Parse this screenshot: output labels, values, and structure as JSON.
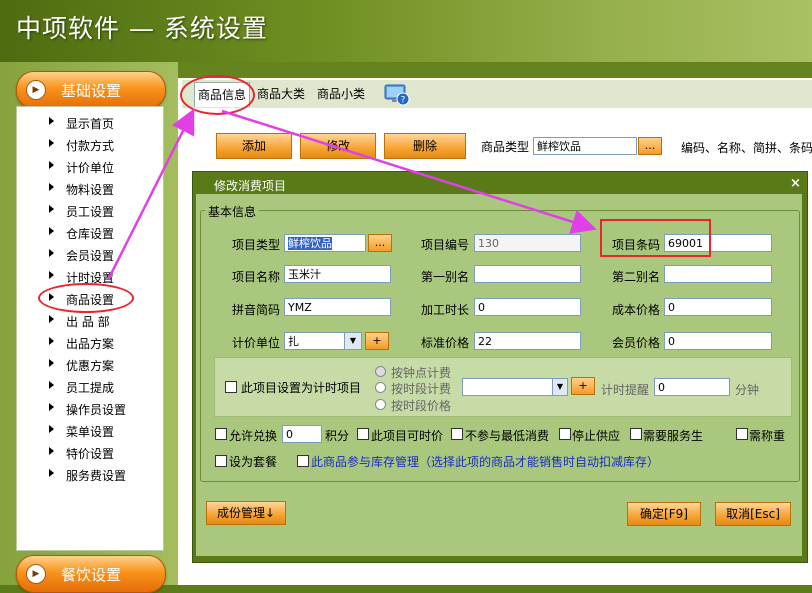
{
  "app": {
    "title": "中项软件 — 系统设置"
  },
  "sidebar": {
    "group_top": "基础设置",
    "group_bottom": "餐饮设置",
    "items": [
      "显示首页",
      "付款方式",
      "计价单位",
      "物料设置",
      "员工设置",
      "仓库设置",
      "会员设置",
      "计时设置",
      "商品设置",
      "出 品 部",
      "出品方案",
      "优惠方案",
      "员工提成",
      "操作员设置",
      "菜单设置",
      "特价设置",
      "服务费设置"
    ]
  },
  "tabs": [
    {
      "label": "商品信息",
      "active": true
    },
    {
      "label": "商品大类"
    },
    {
      "label": "商品小类"
    }
  ],
  "toolbar": {
    "add": "添加",
    "edit": "修改",
    "delete": "删除",
    "type_label": "商品类型",
    "type_value": "鲜榨饮品",
    "dots": "...",
    "search_hint": "编码、名称、简拼、条码"
  },
  "dialog": {
    "title": "修改消费项目",
    "close": "×",
    "group": "基本信息",
    "fields": {
      "type_label": "项目类型",
      "type_value": "鲜榨饮品",
      "code_label": "项目编号",
      "code_value": "130",
      "barcode_label": "项目条码",
      "barcode_value": "69001",
      "name_label": "项目名称",
      "name_value": "玉米汁",
      "alias1_label": "第一别名",
      "alias2_label": "第二别名",
      "pinyin_label": "拼音简码",
      "pinyin_value": "YMZ",
      "process_label": "加工时长",
      "process_value": "0",
      "cost_label": "成本价格",
      "cost_value": "0",
      "unit_label": "计价单位",
      "unit_value": "扎",
      "plus": "+",
      "std_label": "标准价格",
      "std_value": "22",
      "member_label": "会员价格",
      "member_value": "0"
    },
    "timing": {
      "checkbox": "此项目设置为计时项目",
      "radios": [
        "按钟点计费",
        "按时段计费",
        "按时段价格"
      ],
      "remind_label": "计时提醒",
      "remind_value": "0",
      "unit": "分钟"
    },
    "options": {
      "exchange": "允许兑换",
      "exchange_value": "0",
      "points": "积分",
      "timed_price": "此项目可时价",
      "no_min": "不参与最低消费",
      "stop": "停止供应",
      "need_staff": "需要服务生",
      "need_weigh": "需称重",
      "set_meal": "设为套餐",
      "stock": "此商品参与库存管理（选择此项的商品才能销售时自动扣减库存）"
    },
    "buttons": {
      "component": "成份管理↓",
      "ok": "确定[F9]",
      "cancel": "取消[Esc]"
    }
  },
  "colors": {
    "header_green": "#5c7a18",
    "pill_orange": "#f39420",
    "annotation_red": "#e8262b",
    "annotation_magenta": "#e040e6",
    "dialog_body": "#a9c87d"
  }
}
